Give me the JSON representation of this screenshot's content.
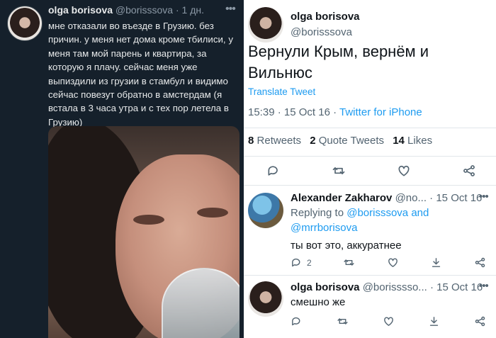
{
  "left_tweet": {
    "author_name": "olga borisova",
    "handle": "@borisssova",
    "separator": "·",
    "time": "1 дн.",
    "text": "мне отказали во въезде в Грузию. без причин. у меня нет дома кроме тбилиси, у меня там мой парень и квартира, за которую я плачу. сейчас меня уже выпиздили из грузии в стамбул и видимо сейчас повезут обратно в амстердам (я встала в 3 часа утра и с тех пор летела в Грузию)",
    "more_icon": "more-icon"
  },
  "main_tweet": {
    "author_name": "olga borisova",
    "handle": "@borisssova",
    "text": "Вернули Крым, вернём и Вильнюс",
    "translate_label": "Translate Tweet",
    "time": "15:39",
    "separator": "·",
    "date": "15 Oct 16",
    "separator2": "·",
    "source": "Twitter for iPhone",
    "retweets_count": "8",
    "retweets_label": "Retweets",
    "quotes_count": "2",
    "quotes_label": "Quote Tweets",
    "likes_count": "14",
    "likes_label": "Likes"
  },
  "replies": [
    {
      "author_name": "Alexander Zakharov",
      "handle": "@no...",
      "separator": "·",
      "date": "15 Oct 16",
      "replying_to_label": "Replying to",
      "replying_handle1": "@borisssova",
      "and_label": "and",
      "replying_handle2": "@mrrborisova",
      "text": "ты вот это, аккуратнее",
      "reply_count": "2"
    },
    {
      "author_name": "olga borisova",
      "handle": "@borisssso...",
      "separator": "·",
      "date": "15 Oct 16",
      "text": "смешно же"
    }
  ],
  "colors": {
    "dark_bg": "#15202b",
    "accent": "#1d9bf0",
    "muted": "#536471"
  }
}
